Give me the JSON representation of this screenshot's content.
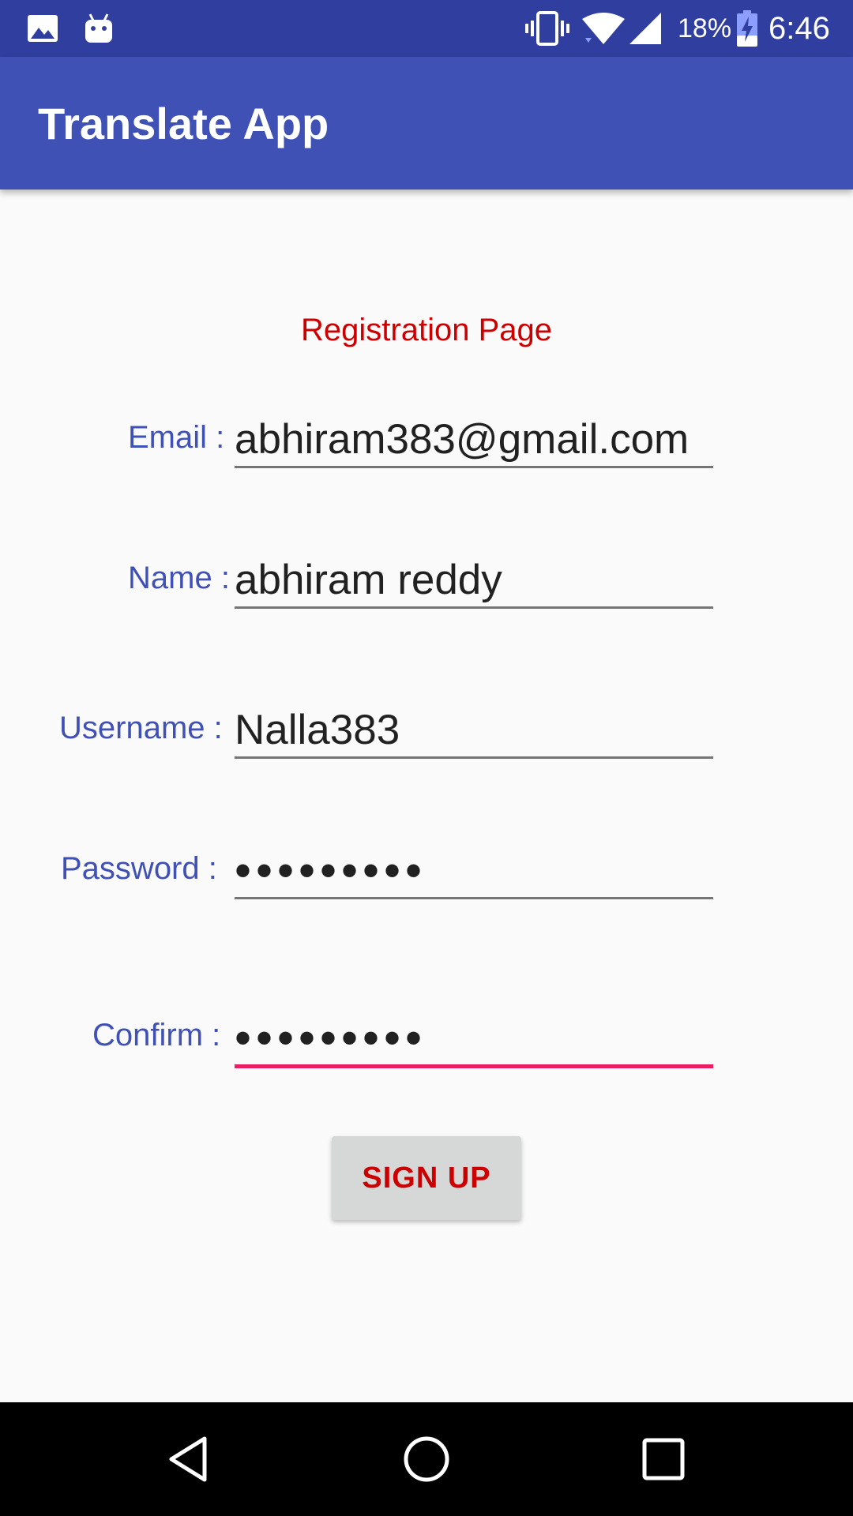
{
  "status_bar": {
    "battery_percent": "18%",
    "time": "6:46",
    "icons": [
      "image-icon",
      "android-icon",
      "vibrate-icon",
      "wifi-icon",
      "signal-icon",
      "battery-charging-icon"
    ]
  },
  "app_bar": {
    "title": "Translate App"
  },
  "form": {
    "heading": "Registration Page",
    "email": {
      "label": "Email :",
      "value": "abhiram383@gmail.com"
    },
    "name": {
      "label": "Name :",
      "value": "abhiram reddy"
    },
    "username": {
      "label": "Username :",
      "value": "Nalla383"
    },
    "password": {
      "label": "Password :",
      "value": "•••••••••"
    },
    "confirm": {
      "label": "Confirm :",
      "value": "•••••••••"
    },
    "submit_label": "SIGN UP"
  },
  "nav_bar": {
    "icons": [
      "back-icon",
      "home-icon",
      "recents-icon"
    ]
  },
  "colors": {
    "status_bar": "#303f9f",
    "app_bar": "#3f51b5",
    "label": "#3f51b5",
    "heading": "#cc0000",
    "focus_underline": "#e91e63"
  }
}
